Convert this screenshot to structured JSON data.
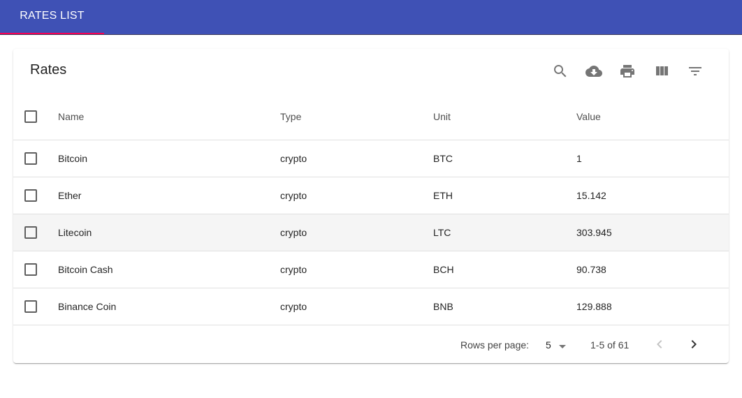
{
  "app": {
    "tab_label": "RATES LIST",
    "colors": {
      "appbar": "#3f51b5",
      "tab_indicator": "#f50057",
      "row_highlight": "#f5f5f5"
    }
  },
  "table": {
    "title": "Rates",
    "toolbar_icons": [
      "search-icon",
      "cloud-download-icon",
      "print-icon",
      "view-column-icon",
      "filter-list-icon"
    ],
    "columns": [
      "Name",
      "Type",
      "Unit",
      "Value"
    ],
    "rows": [
      {
        "name": "Bitcoin",
        "type": "crypto",
        "unit": "BTC",
        "value": "1"
      },
      {
        "name": "Ether",
        "type": "crypto",
        "unit": "ETH",
        "value": "15.142"
      },
      {
        "name": "Litecoin",
        "type": "crypto",
        "unit": "LTC",
        "value": "303.945"
      },
      {
        "name": "Bitcoin Cash",
        "type": "crypto",
        "unit": "BCH",
        "value": "90.738"
      },
      {
        "name": "Binance Coin",
        "type": "crypto",
        "unit": "BNB",
        "value": "129.888"
      }
    ],
    "highlighted_row": "Litecoin"
  },
  "pagination": {
    "rows_per_page_label": "Rows per page:",
    "rows_per_page": "5",
    "range": "1-5 of 61"
  }
}
